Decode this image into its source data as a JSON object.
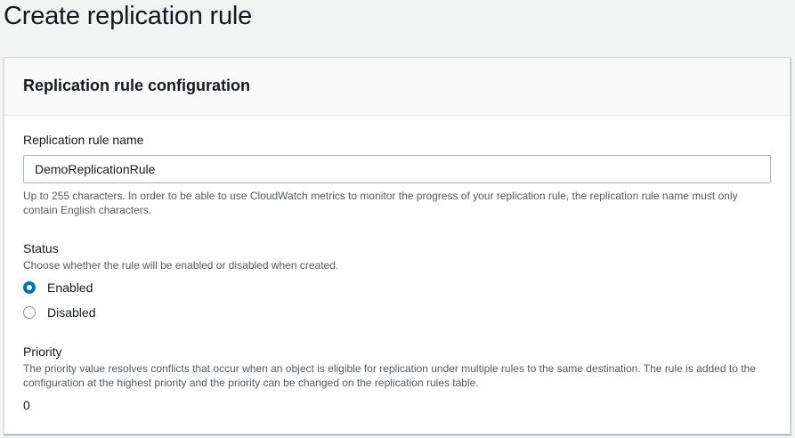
{
  "page": {
    "title": "Create replication rule"
  },
  "panel": {
    "title": "Replication rule configuration",
    "rule_name": {
      "label": "Replication rule name",
      "value": "DemoReplicationRule",
      "description": "Up to 255 characters. In order to be able to use CloudWatch metrics to monitor the progress of your replication rule, the replication rule name must only contain English characters."
    },
    "status": {
      "label": "Status",
      "description": "Choose whether the rule will be enabled or disabled when created.",
      "options": [
        {
          "label": "Enabled",
          "selected": true
        },
        {
          "label": "Disabled",
          "selected": false
        }
      ]
    },
    "priority": {
      "label": "Priority",
      "description": "The priority value resolves conflicts that occur when an object is eligible for replication under multiple rules to the same destination. The rule is added to the configuration at the highest priority and the priority can be changed on the replication rules table.",
      "value": "0"
    }
  },
  "colors": {
    "accent": "#0073bb",
    "background": "#f2f3f3",
    "text": "#16191f",
    "muted": "#545b64"
  }
}
